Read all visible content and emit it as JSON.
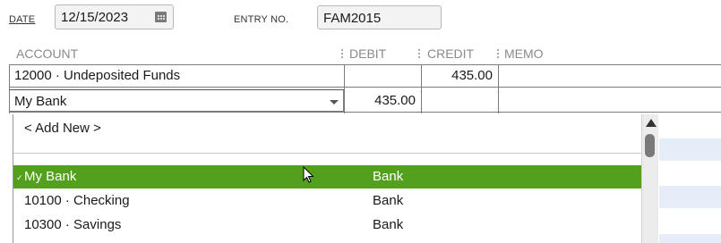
{
  "date": {
    "label": "DATE",
    "value": "12/15/2023"
  },
  "entry": {
    "label": "ENTRY NO.",
    "value": "FAM2015"
  },
  "columns": {
    "account": "ACCOUNT",
    "debit": "DEBIT",
    "credit": "CREDIT",
    "memo": "MEMO"
  },
  "rows": [
    {
      "account": "12000 · Undeposited Funds",
      "debit": "",
      "credit": "435.00",
      "memo": ""
    },
    {
      "account": "My Bank",
      "debit": "435.00",
      "credit": "",
      "memo": ""
    }
  ],
  "dropdown": {
    "add_new": "< Add New >",
    "items": [
      {
        "name": "My Bank",
        "type": "Bank",
        "selected": true
      },
      {
        "name": "10100 · Checking",
        "type": "Bank",
        "selected": false
      },
      {
        "name": "10300 · Savings",
        "type": "Bank",
        "selected": false
      }
    ]
  },
  "colors": {
    "selection": "#53a01f",
    "row_stripe": "#e4edf8"
  },
  "icons": {
    "date_picker": "calendar-icon",
    "combo": "chevron-down-icon",
    "scroll_up": "scroll-up-icon",
    "pointer": "mouse-pointer-icon"
  }
}
